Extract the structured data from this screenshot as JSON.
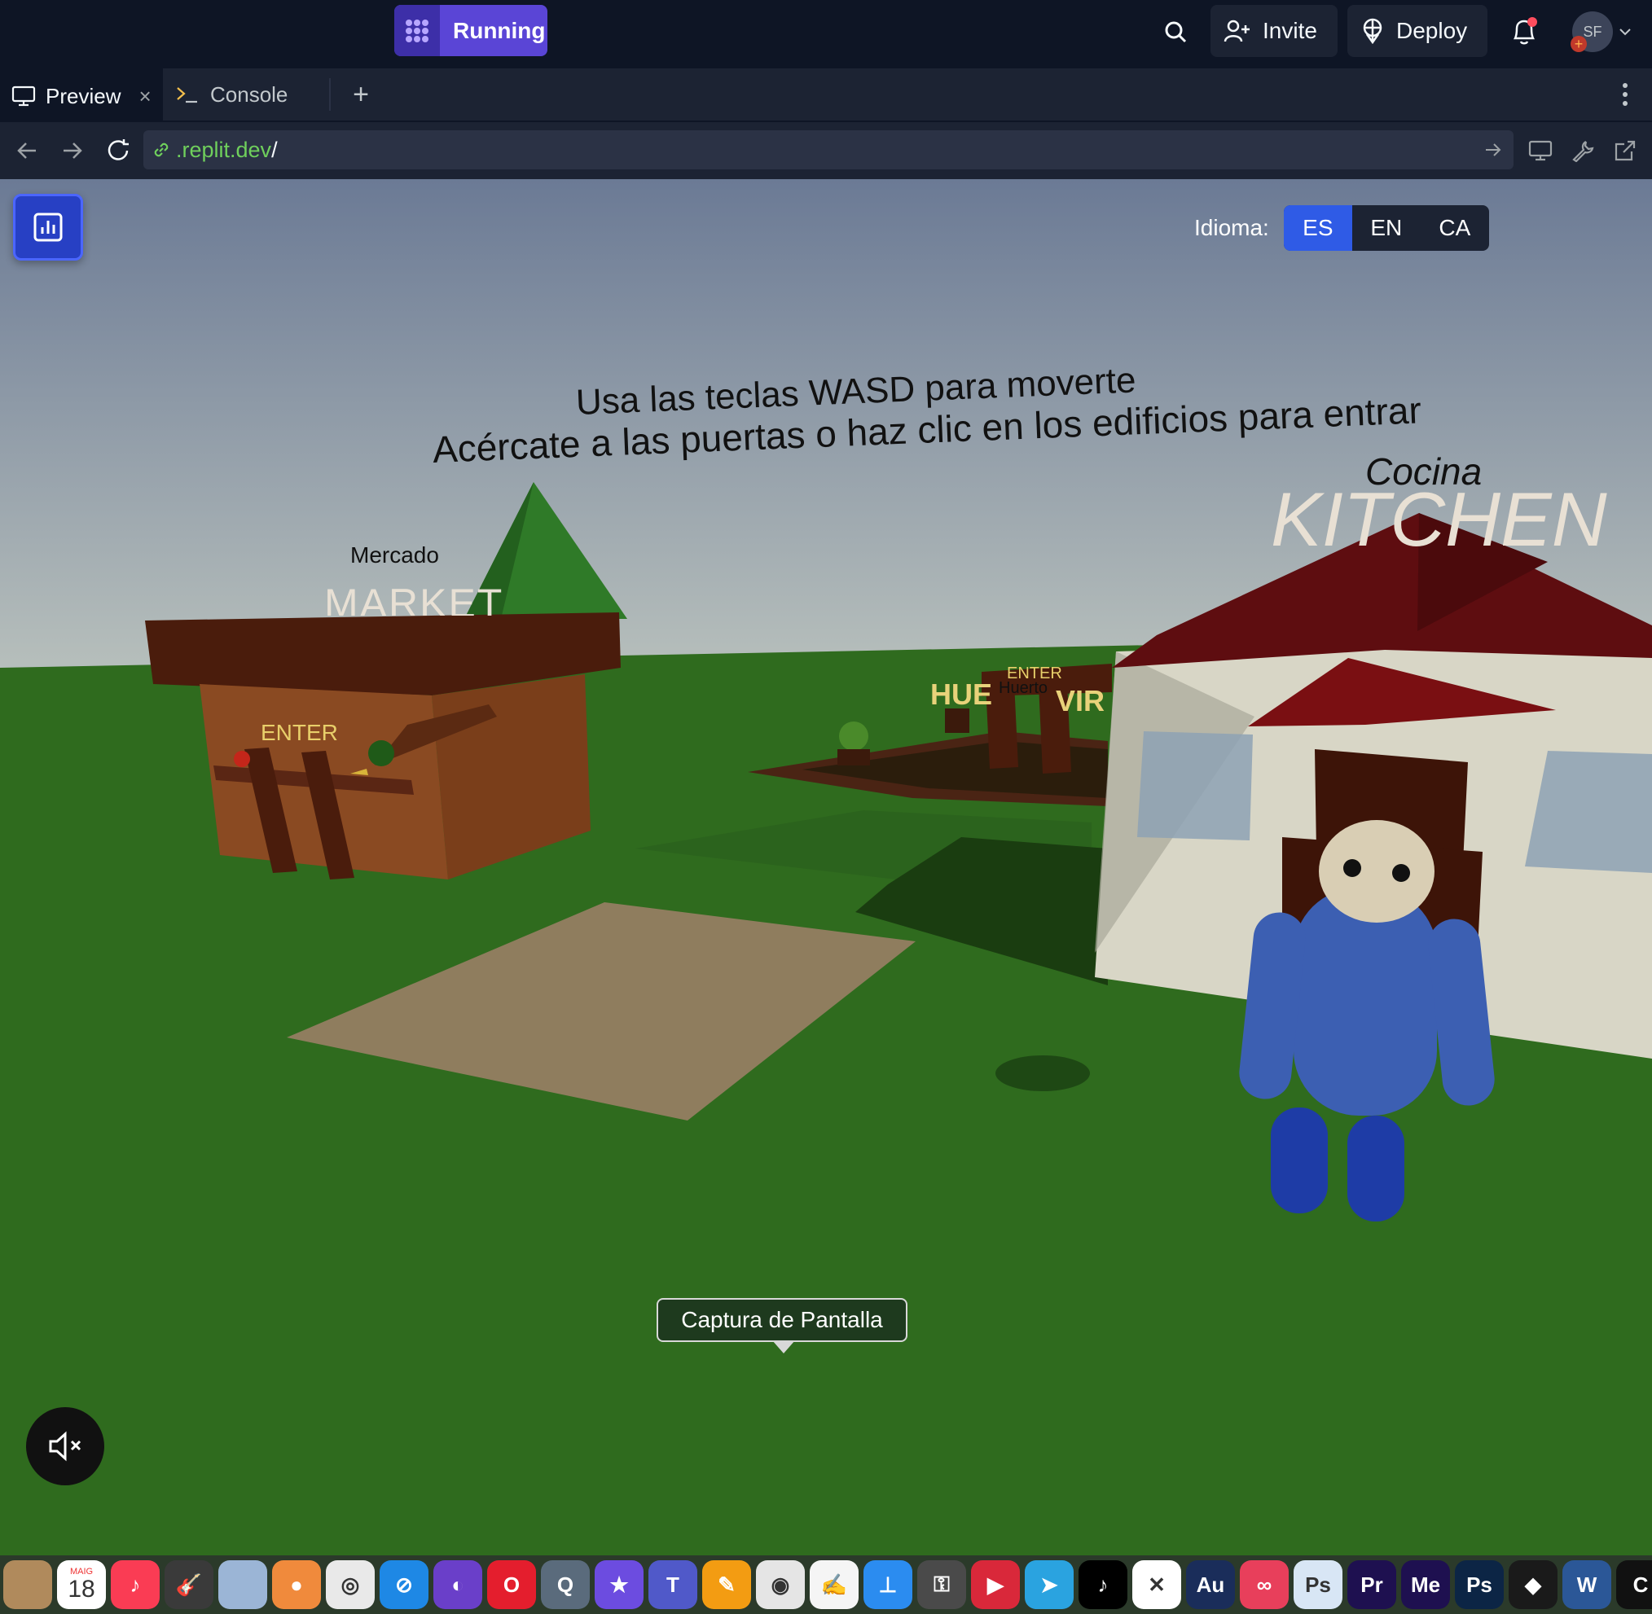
{
  "topbar": {
    "run_label": "Running",
    "invite_label": "Invite",
    "deploy_label": "Deploy",
    "avatar_initials": "SF"
  },
  "tabs": [
    {
      "label": "Preview",
      "icon": "monitor-icon",
      "active": true
    },
    {
      "label": "Console",
      "icon": "terminal-icon",
      "active": false
    }
  ],
  "url": {
    "domain": ".replit.dev",
    "path": "/"
  },
  "game": {
    "lang_label": "Idioma:",
    "languages": [
      "ES",
      "EN",
      "CA"
    ],
    "selected_language": "ES",
    "instructions_line1": "Usa las teclas WASD para moverte",
    "instructions_line2": "Acércate a las puertas o haz clic en los edificios para entrar",
    "market_sub": "Mercado",
    "market_title": "MARKET",
    "market_enter": "ENTER",
    "kitchen_sub": "Cocina",
    "kitchen_title": "KITCHEN",
    "garden_enter": "ENTER",
    "garden_sub": "Huerto",
    "garden_title_left": "HUE",
    "garden_title_right": "VIR"
  },
  "tooltip": "Captura de Pantalla",
  "dock": {
    "calendar_month": "MAIG",
    "calendar_day": "18",
    "apps": [
      {
        "name": "contacts-icon",
        "label": "",
        "color": "#b08a5c"
      },
      {
        "name": "calendar-icon",
        "label": "18",
        "color": "#ffffff"
      },
      {
        "name": "music-icon",
        "label": "♪",
        "color": "#fa3c54"
      },
      {
        "name": "garageband-icon",
        "label": "🎸",
        "color": "#3a3a3a"
      },
      {
        "name": "preview-icon",
        "label": "",
        "color": "#9bb5d6"
      },
      {
        "name": "video-icon",
        "label": "●",
        "color": "#f08a3c"
      },
      {
        "name": "chrome-icon",
        "label": "◎",
        "color": "#e9e9e9"
      },
      {
        "name": "safari-icon",
        "label": "⊘",
        "color": "#1e88e5"
      },
      {
        "name": "tor-icon",
        "label": "◐",
        "color": "#6a3fc9"
      },
      {
        "name": "opera-icon",
        "label": "O",
        "color": "#e41e2d"
      },
      {
        "name": "quicktime-icon",
        "label": "Q",
        "color": "#5a6b7c"
      },
      {
        "name": "imovie-icon",
        "label": "★",
        "color": "#6c4ce0"
      },
      {
        "name": "teams-icon",
        "label": "T",
        "color": "#5059c9"
      },
      {
        "name": "pages-icon",
        "label": "✎",
        "color": "#f39c12"
      },
      {
        "name": "screenshot-icon",
        "label": "◉",
        "color": "#e5e5e5"
      },
      {
        "name": "textedit-icon",
        "label": "✍",
        "color": "#f5f5f5"
      },
      {
        "name": "keynote-icon",
        "label": "⊥",
        "color": "#2b8cf0"
      },
      {
        "name": "keychain-icon",
        "label": "⚿",
        "color": "#4a4a4a"
      },
      {
        "name": "pdf-icon",
        "label": "▶",
        "color": "#d9283a"
      },
      {
        "name": "telegram-icon",
        "label": "➤",
        "color": "#2aa3e0"
      },
      {
        "name": "tiktok-icon",
        "label": "♪",
        "color": "#000000"
      },
      {
        "name": "capcut-icon",
        "label": "✕",
        "color": "#ffffff"
      },
      {
        "name": "audition-icon",
        "label": "Au",
        "color": "#1a2d5a"
      },
      {
        "name": "creative-cloud-icon",
        "label": "∞",
        "color": "#e83f5b"
      },
      {
        "name": "photoshop-alt-icon",
        "label": "Ps",
        "color": "#d8e6f5"
      },
      {
        "name": "premiere-icon",
        "label": "Pr",
        "color": "#1e1050"
      },
      {
        "name": "media-encoder-icon",
        "label": "Me",
        "color": "#1e1050"
      },
      {
        "name": "photoshop-icon",
        "label": "Ps",
        "color": "#0c2545"
      },
      {
        "name": "binance-icon",
        "label": "◆",
        "color": "#1a1a1a"
      },
      {
        "name": "word-icon",
        "label": "W",
        "color": "#2b5797"
      },
      {
        "name": "cursor-icon",
        "label": "C",
        "color": "#111111"
      }
    ]
  }
}
